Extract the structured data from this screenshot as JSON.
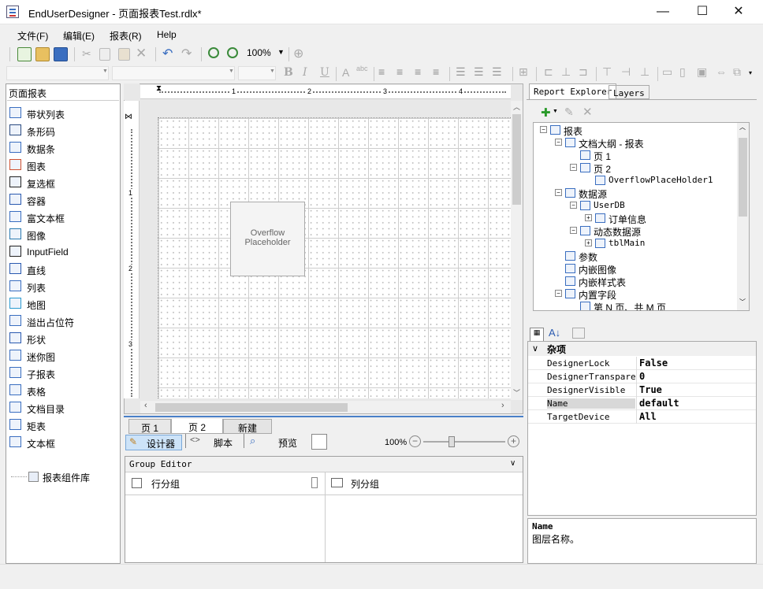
{
  "window": {
    "title": "EndUserDesigner - 页面报表Test.rdlx*",
    "minimize": "—",
    "maximize": "☐",
    "close": "✕"
  },
  "menu": [
    "文件(F)",
    "编辑(E)",
    "报表(R)",
    "Help"
  ],
  "toolbar": {
    "zoom": "100%"
  },
  "toolbox": {
    "title": "页面报表",
    "items": [
      {
        "label": "带状列表",
        "icon": "banded-list-icon"
      },
      {
        "label": "条形码",
        "icon": "barcode-icon"
      },
      {
        "label": "数据条",
        "icon": "databar-icon"
      },
      {
        "label": "图表",
        "icon": "chart-icon"
      },
      {
        "label": "复选框",
        "icon": "checkbox-icon"
      },
      {
        "label": "容器",
        "icon": "container-icon"
      },
      {
        "label": "富文本框",
        "icon": "richtext-icon"
      },
      {
        "label": "图像",
        "icon": "image-icon"
      },
      {
        "label": "InputField",
        "icon": "inputfield-icon"
      },
      {
        "label": "直线",
        "icon": "line-icon"
      },
      {
        "label": "列表",
        "icon": "list-icon"
      },
      {
        "label": "地图",
        "icon": "map-icon"
      },
      {
        "label": "溢出占位符",
        "icon": "overflow-placeholder-icon"
      },
      {
        "label": "形状",
        "icon": "shape-icon"
      },
      {
        "label": "迷你图",
        "icon": "sparkline-icon"
      },
      {
        "label": "子报表",
        "icon": "subreport-icon"
      },
      {
        "label": "表格",
        "icon": "table-icon"
      },
      {
        "label": "文档目录",
        "icon": "toc-icon"
      },
      {
        "label": "矩表",
        "icon": "tablix-icon"
      },
      {
        "label": "文本框",
        "icon": "textbox-icon"
      }
    ],
    "library": "报表组件库"
  },
  "designer": {
    "ruler_top": [
      "1",
      "2",
      "3",
      "4"
    ],
    "ruler_left": [
      "1",
      "2",
      "3"
    ],
    "placeholder_line1": "Overflow",
    "placeholder_line2": "Placeholder",
    "page_tabs": [
      "页 1",
      "页 2",
      "新建"
    ],
    "view_tabs": {
      "designer": "设计器",
      "script": "脚本",
      "preview": "预览"
    },
    "zoom": "100%"
  },
  "group_editor": {
    "title": "Group Editor",
    "row_groups": "行分组",
    "column_groups": "列分组"
  },
  "explorer": {
    "tabs": [
      "Report Explorer",
      "Layers"
    ],
    "tree": [
      {
        "label": "报表",
        "level": 0,
        "expander": "−",
        "icon": "report-icon"
      },
      {
        "label": "文档大纲 - 报表",
        "level": 1,
        "expander": "−",
        "icon": "outline-icon"
      },
      {
        "label": "页 1",
        "level": 2,
        "expander": "",
        "icon": "page-icon"
      },
      {
        "label": "页 2",
        "level": 2,
        "expander": "−",
        "icon": "page-icon"
      },
      {
        "label": "OverflowPlaceHolder1",
        "level": 3,
        "expander": "",
        "icon": "overflow-placeholder-icon"
      },
      {
        "label": "数据源",
        "level": 1,
        "expander": "−",
        "icon": "datasources-icon"
      },
      {
        "label": "UserDB",
        "level": 2,
        "expander": "−",
        "icon": "database-icon"
      },
      {
        "label": "订单信息",
        "level": 3,
        "expander": "+",
        "icon": "dataset-icon"
      },
      {
        "label": "动态数据源",
        "level": 2,
        "expander": "−",
        "icon": "database-icon"
      },
      {
        "label": "tblMain",
        "level": 3,
        "expander": "+",
        "icon": "dataset-icon"
      },
      {
        "label": "参数",
        "level": 1,
        "expander": "",
        "icon": "parameters-icon"
      },
      {
        "label": "内嵌图像",
        "level": 1,
        "expander": "",
        "icon": "embedded-images-icon"
      },
      {
        "label": "内嵌样式表",
        "level": 1,
        "expander": "",
        "icon": "stylesheet-icon"
      },
      {
        "label": "内置字段",
        "level": 1,
        "expander": "−",
        "icon": "builtin-fields-icon"
      },
      {
        "label": "第 N 页、共 M 页",
        "level": 2,
        "expander": "",
        "icon": "field-icon"
      }
    ]
  },
  "properties": {
    "category": "杂项",
    "rows": [
      {
        "key": "DesignerLock",
        "value": "False"
      },
      {
        "key": "DesignerTransparency",
        "value": "0"
      },
      {
        "key": "DesignerVisible",
        "value": "True"
      },
      {
        "key": "Name",
        "value": "default"
      },
      {
        "key": "TargetDevice",
        "value": "All"
      }
    ],
    "help_title": "Name",
    "help_text": "图层名称。"
  }
}
